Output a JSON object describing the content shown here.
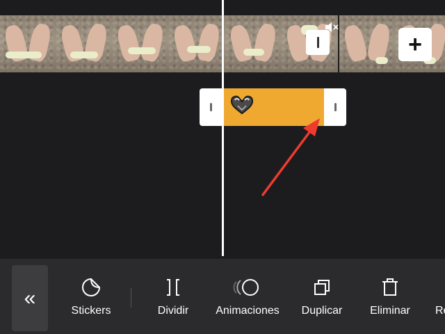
{
  "toolbar": {
    "tools": [
      {
        "label": "Stickers",
        "icon": "sticker-icon"
      },
      {
        "label": "Dividir",
        "icon": "split-icon"
      },
      {
        "label": "Animaciones",
        "icon": "animation-icon"
      },
      {
        "label": "Duplicar",
        "icon": "duplicate-icon"
      },
      {
        "label": "Eliminar",
        "icon": "trash-icon"
      },
      {
        "label": "Re",
        "icon": "partial-tool-icon"
      }
    ],
    "back_icon": "double-chevron-left-icon"
  },
  "timeline": {
    "add_icon": "plus-icon",
    "mute_icon": "muted-speaker-icon",
    "sticker_icon": "heart-hands-sticker-icon"
  },
  "colors": {
    "background": "#1c1c1e",
    "toolbar": "#2b2b2d",
    "sticker_clip": "#efa931",
    "arrow": "#ee3b2f"
  }
}
